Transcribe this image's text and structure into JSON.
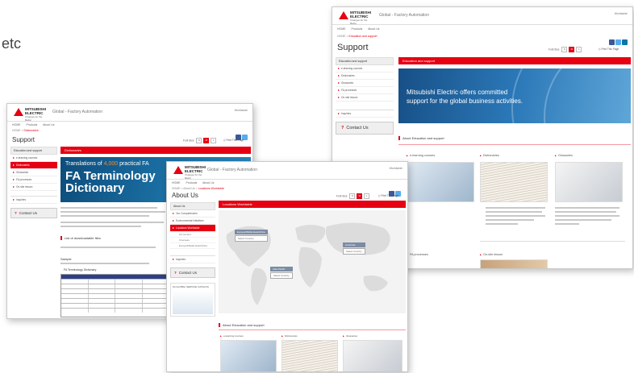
{
  "fragment_text": "etc",
  "shot_dictionary": {
    "site_title": "Global - Factory Automation",
    "worldwide": "Worldwide",
    "nav": [
      "HOME",
      "Products",
      "About Us"
    ],
    "breadcrumb_home": "HOME",
    "breadcrumb_current": "Dictionaries",
    "page_title": "Support",
    "font_size_label": "Font Size",
    "print_label": "Print This Page",
    "sidebar_head": "Education and support",
    "sidebar_items": [
      "e-learning courses",
      "Dictionaries",
      "Glossaries",
      "FA processes",
      "On-site lesson"
    ],
    "sidebar_selected_index": 1,
    "inquiries": "Inquiries",
    "contact": "Contact Us",
    "redbar": "Dictionaries",
    "banner_line1_a": "Translations of ",
    "banner_line1_b": "4,000",
    "banner_line1_c": " practical FA",
    "banner_big_1": "FA Terminology",
    "banner_big_2": "Dictionary",
    "section_title": "List of downloadable files",
    "sample_label": "Sample",
    "table_title": "FA Terminology Dictionary",
    "colors": {
      "accent": "#e60012",
      "banner": "#1b6fa3",
      "highlight": "#ff8a1e"
    }
  },
  "shot_locations": {
    "site_title": "Global - Factory Automation",
    "worldwide": "Worldwide",
    "nav": [
      "HOME",
      "Products",
      "About Us"
    ],
    "breadcrumb_home": "HOME",
    "breadcrumb_mid": "About Us",
    "breadcrumb_current": "Locations Worldwide",
    "page_title": "About Us",
    "font_size_label": "Font Size",
    "print_label": "Print This Page",
    "sidebar_head": "About Us",
    "sidebar_items": [
      "Our Competencies",
      "Environmental Initiatives",
      "Locations Worldwide"
    ],
    "sidebar_selected_index": 2,
    "sidebar_sub": [
      "FA Centers",
      "Overseas",
      "Europe/Middle East/Africa"
    ],
    "inquiries": "Inquiries",
    "contact": "Contact Us",
    "service_title": "FA GLOBAL SERVICE CATALOG",
    "redbar": "Locations Worldwide",
    "regions": [
      {
        "name": "Europe/Middle East/Africa",
        "select": "Select Country"
      },
      {
        "name": "Asia Pacific",
        "select": "Select Country"
      },
      {
        "name": "Americas",
        "select": "Select Country"
      }
    ],
    "section_title": "About Education and support",
    "columns": [
      "e-learning courses",
      "Dictionaries",
      "Glossaries"
    ]
  },
  "shot_education": {
    "site_title": "Global - Factory Automation",
    "worldwide": "Worldwide",
    "nav": [
      "HOME",
      "Products",
      "About Us"
    ],
    "breadcrumb_home": "HOME",
    "breadcrumb_current": "Education and support",
    "page_title": "Support",
    "font_size_label": "Font Size",
    "print_label": "Print This Page",
    "sidebar_head": "Education and support",
    "sidebar_items": [
      "e-learning courses",
      "Dictionaries",
      "Glossaries",
      "FA processes",
      "On-site lesson"
    ],
    "inquiries": "Inquiries",
    "contact": "Contact Us",
    "redbar": "Education and support",
    "banner_text_1": "Mitsubishi Electric offers committed",
    "banner_text_2": "support for the global business activities.",
    "section_title": "About Education and support",
    "columns": [
      "e-learning courses",
      "Dictionaries",
      "Glossaries"
    ],
    "bottom_columns": [
      "FA processes",
      "On-site lesson"
    ]
  },
  "logo_word": "MITSUBISHI ELECTRIC",
  "logo_tag": "Changes for the Better"
}
